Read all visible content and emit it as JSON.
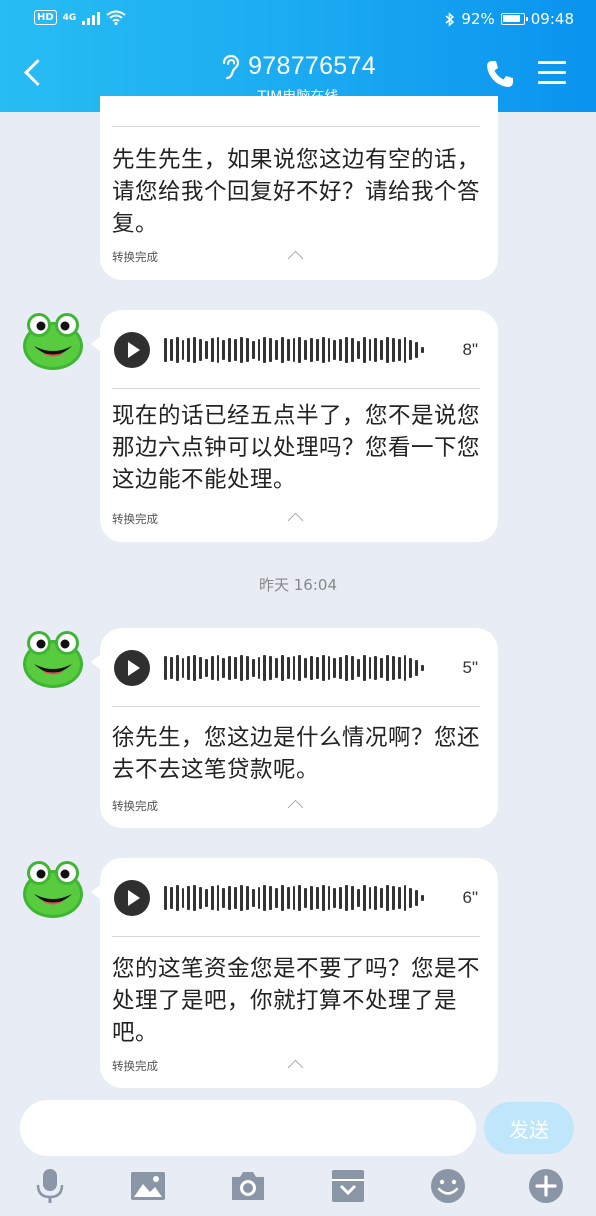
{
  "status_bar": {
    "hd": "HD",
    "signal": "4G",
    "battery": "92%",
    "time": "09:48"
  },
  "header": {
    "title": "978776574",
    "subtitle": "TIM电脑在线"
  },
  "messages": [
    {
      "type": "voice_partial",
      "text": "先生先生，如果说您这边有空的话，请您给我个回复好不好？请给我个答复。",
      "status": "转换完成"
    },
    {
      "type": "voice",
      "duration": "8\"",
      "text": "现在的话已经五点半了，您不是说您那边六点钟可以处理吗？您看一下您这边能不能处理。",
      "status": "转换完成"
    },
    {
      "type": "timestamp",
      "text": "昨天 16:04"
    },
    {
      "type": "voice",
      "duration": "5\"",
      "text": "徐先生，您这边是什么情况啊？您还去不去这笔贷款呢。",
      "status": "转换完成"
    },
    {
      "type": "voice",
      "duration": "6\"",
      "text": "您的这笔资金您是不要了吗？您是不处理了是吧，你就打算不处理了是吧。",
      "status": "转换完成"
    }
  ],
  "input": {
    "placeholder": "",
    "send_label": "发送"
  },
  "toolbar": [
    "microphone-icon",
    "image-icon",
    "camera-icon",
    "archive-icon",
    "emoji-icon",
    "plus-icon"
  ],
  "colors": {
    "header_start": "#27bdf3",
    "header_end": "#0a93ef",
    "background": "#e8edf5",
    "send_button": "#bfe6fb"
  }
}
